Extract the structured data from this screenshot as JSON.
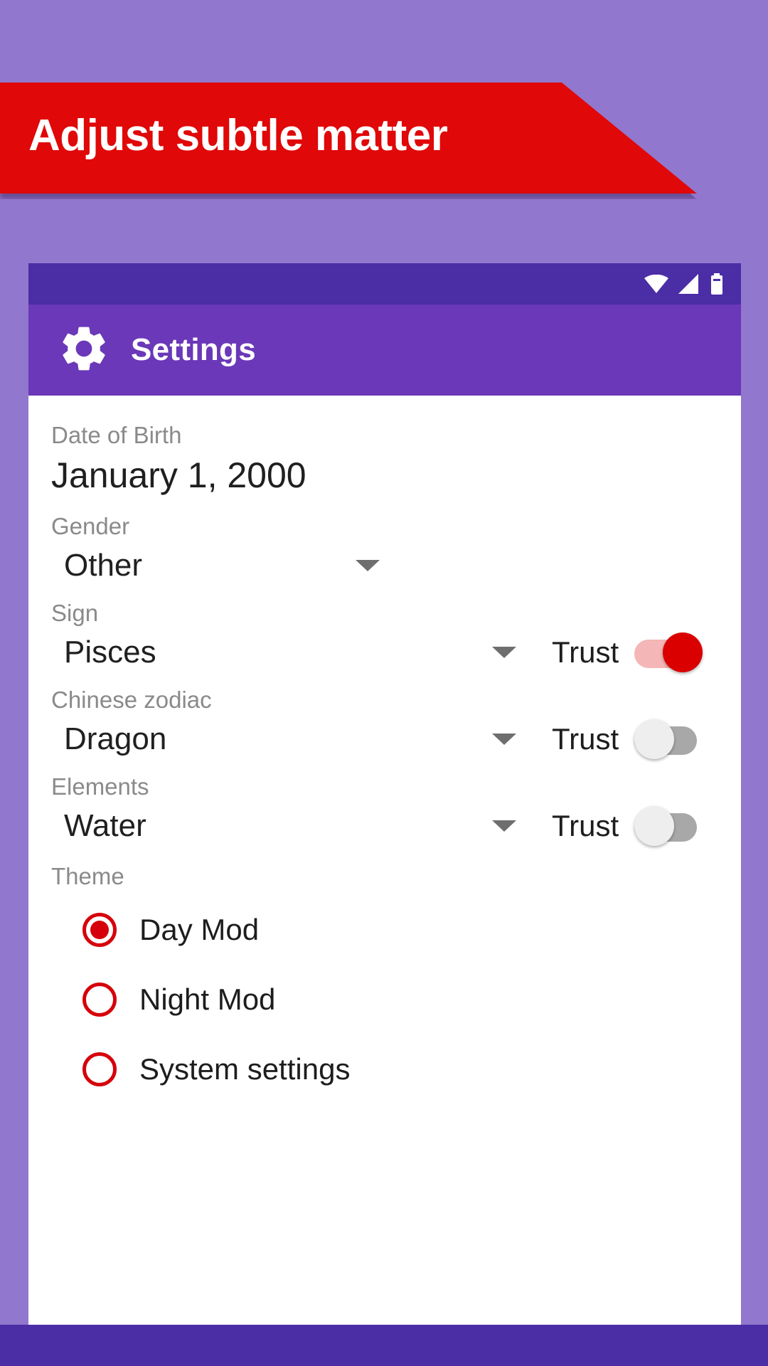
{
  "banner": {
    "text": "Adjust subtle matter",
    "bg_color": "#e00808",
    "text_color": "#ffffff"
  },
  "page": {
    "background_color": "#9277ce"
  },
  "status_bar": {
    "background_color": "#4b2da5",
    "icons": [
      "wifi-icon",
      "signal-icon",
      "battery-icon"
    ]
  },
  "app_bar": {
    "background_color": "#6a38b8",
    "icon": "gear-icon",
    "title": "Settings"
  },
  "form": {
    "date_of_birth": {
      "label": "Date of Birth",
      "value": "January 1, 2000"
    },
    "gender": {
      "label": "Gender",
      "value": "Other"
    },
    "sign": {
      "label": "Sign",
      "value": "Pisces",
      "trust_label": "Trust",
      "trust_on": true
    },
    "chinese_zodiac": {
      "label": "Chinese zodiac",
      "value": "Dragon",
      "trust_label": "Trust",
      "trust_on": false
    },
    "elements": {
      "label": "Elements",
      "value": "Water",
      "trust_label": "Trust",
      "trust_on": false
    },
    "theme": {
      "label": "Theme",
      "options": [
        {
          "label": "Day Mod",
          "selected": true
        },
        {
          "label": "Night Mod",
          "selected": false
        },
        {
          "label": "System settings",
          "selected": false
        }
      ]
    }
  },
  "nav_bar": {
    "background_color": "#4b2da5"
  },
  "colors": {
    "accent_red": "#d6000a",
    "purple_dark": "#4b2da5",
    "purple_app_bar": "#6a38b8",
    "purple_bg": "#9277ce"
  }
}
